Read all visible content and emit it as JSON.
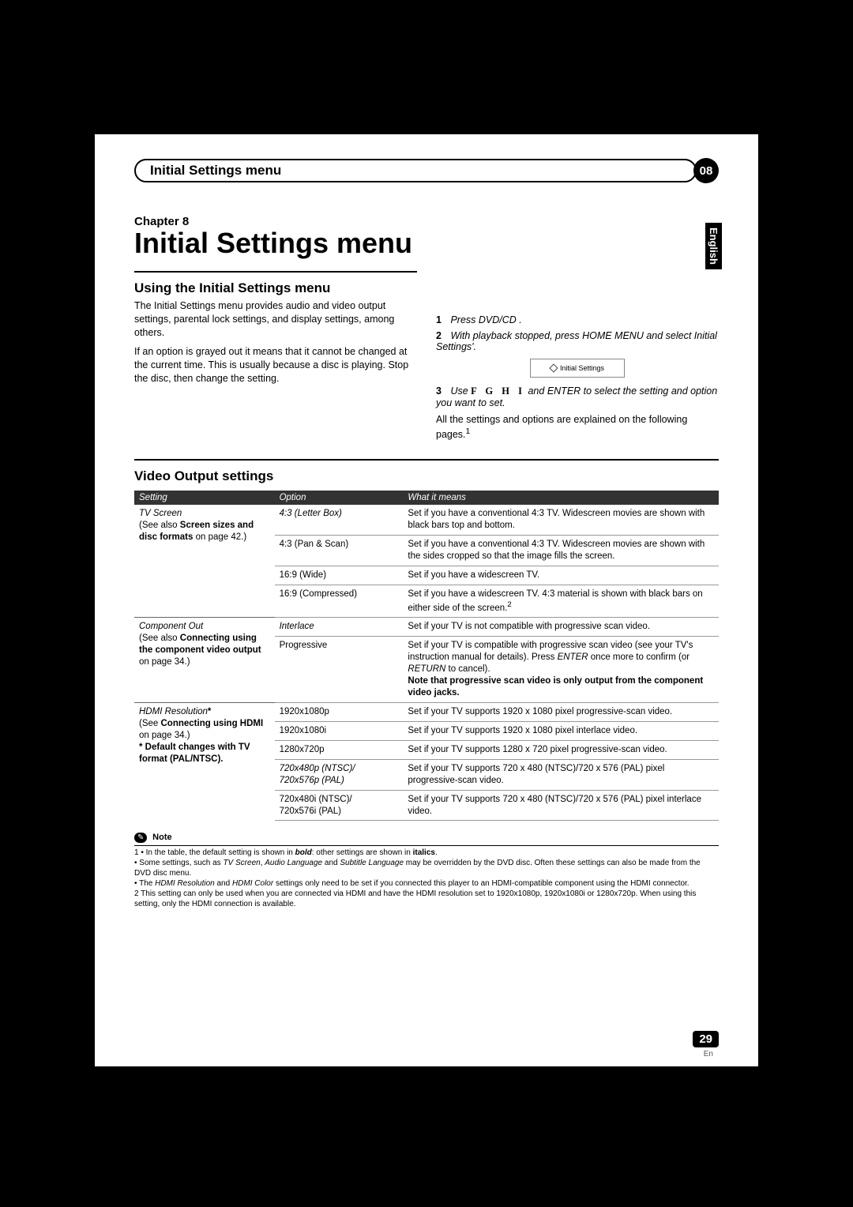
{
  "header": {
    "title": "Initial Settings menu",
    "chapter_number": "08"
  },
  "language_tab": "English",
  "main": {
    "chapter_label": "Chapter 8",
    "title": "Initial Settings menu",
    "using_heading": "Using the Initial Settings menu",
    "using_p1": "The Initial Settings menu provides audio and video output settings, parental lock settings, and display settings, among others.",
    "using_p2": "If an option is grayed out it means that it cannot be changed at the current time. This is usually because a disc is playing. Stop the disc, then change the setting.",
    "step1_n": "1",
    "step1": "Press DVD/CD .",
    "step2_n": "2",
    "step2": "With playback stopped, press  HOME MENU and select Initial Settings'.",
    "screenshot_label": "Initial Settings",
    "step3_n": "3",
    "step3a": "Use  ",
    "step3b": " and ENTER to select the setting and option you want to set.",
    "step3_keys": "F  G  H  I",
    "step3_after": "All the settings and options are explained on the following pages.",
    "sup1": "1"
  },
  "video": {
    "heading": "Video Output settings",
    "columns": {
      "setting": "Setting",
      "option": "Option",
      "what": "What it means"
    },
    "groups": [
      {
        "setting_italic": "TV Screen",
        "setting_rest": "(See also Screen sizes and disc formats on page 42.)",
        "setting_bold_parts": [
          "Screen sizes and disc formats"
        ],
        "rows": [
          {
            "option_italic": "4:3 (Letter Box)",
            "what": "Set if you have a conventional 4:3 TV. Widescreen movies are shown with black bars top and bottom."
          },
          {
            "option": "4:3 (Pan & Scan)",
            "what": "Set if you have a conventional 4:3 TV. Widescreen movies are shown with the sides cropped so that the image fills the screen."
          },
          {
            "option": "16:9 (Wide)",
            "what": "Set if you have a widescreen TV."
          },
          {
            "option": "16:9 (Compressed)",
            "what": "Set if you have a widescreen TV. 4:3 material is shown with black bars on either side of the screen.",
            "sup": "2"
          }
        ]
      },
      {
        "setting_italic": "Component Out",
        "setting_rest": "(See also Connecting using the component video output on page 34.)",
        "rows": [
          {
            "option_italic": "Interlace",
            "what": "Set if your TV is not compatible with progressive scan video."
          },
          {
            "option": "Progressive",
            "what_pre": "Set if your TV is compatible with progressive scan video (see your TV's instruction manual for details). Press ",
            "what_enter": "ENTER",
            "what_mid": " once more to confirm (or ",
            "what_return": "RETURN",
            "what_post": " to cancel).",
            "what_bold": "Note that progressive scan video is only output from the component video jacks."
          }
        ]
      },
      {
        "setting_italic": "HDMI Resolution",
        "setting_star": "*",
        "setting_rest": "(See Connecting using HDMI on page 34.)",
        "setting_note": "* Default changes with TV format (PAL/NTSC).",
        "rows": [
          {
            "option": "1920x1080p",
            "what": "Set if your TV supports 1920 x 1080 pixel progressive-scan video."
          },
          {
            "option": "1920x1080i",
            "what": "Set if your TV supports 1920 x 1080 pixel interlace video."
          },
          {
            "option": "1280x720p",
            "what": "Set if your TV supports 1280 x 720 pixel progressive-scan video."
          },
          {
            "option_italic": "720x480p (NTSC)/\n720x576p (PAL)",
            "what": "Set if your TV supports 720 x 480 (NTSC)/720 x 576 (PAL) pixel progressive-scan video."
          },
          {
            "option": "720x480i (NTSC)/\n720x576i (PAL)",
            "what": "Set if your TV supports 720 x 480 (NTSC)/720 x 576 (PAL) pixel interlace video."
          }
        ]
      }
    ]
  },
  "notes": {
    "label_icon": "✎",
    "label": "Note",
    "n1a": "1 • In the table, the default setting is shown in ",
    "n1b": "bold",
    "n1c": ": other settings are shown in ",
    "n1d": "italics",
    "n1e": ".",
    "n2a": "  • Some settings, such as ",
    "n2b": "TV Screen",
    "n2c": ", ",
    "n2d": "Audio Language",
    "n2e": "  and ",
    "n2f": "Subtitle Language",
    "n2g": " may be overridden by the DVD disc. Often these settings can also be made from the DVD disc menu.",
    "n3a": "  • The ",
    "n3b": "HDMI Resolution",
    "n3c": "  and ",
    "n3d": "HDMI Color",
    "n3e": "  settings only need to be set if you connected this player to an HDMI-compatible component using the HDMI connector.",
    "n4": "2  This setting can only be used when you are connected via HDMI and have the HDMI resolution set to 1920x1080p, 1920x1080i or 1280x720p. When using this setting, only the HDMI connection is available."
  },
  "footer": {
    "page": "29",
    "lang": "En"
  }
}
